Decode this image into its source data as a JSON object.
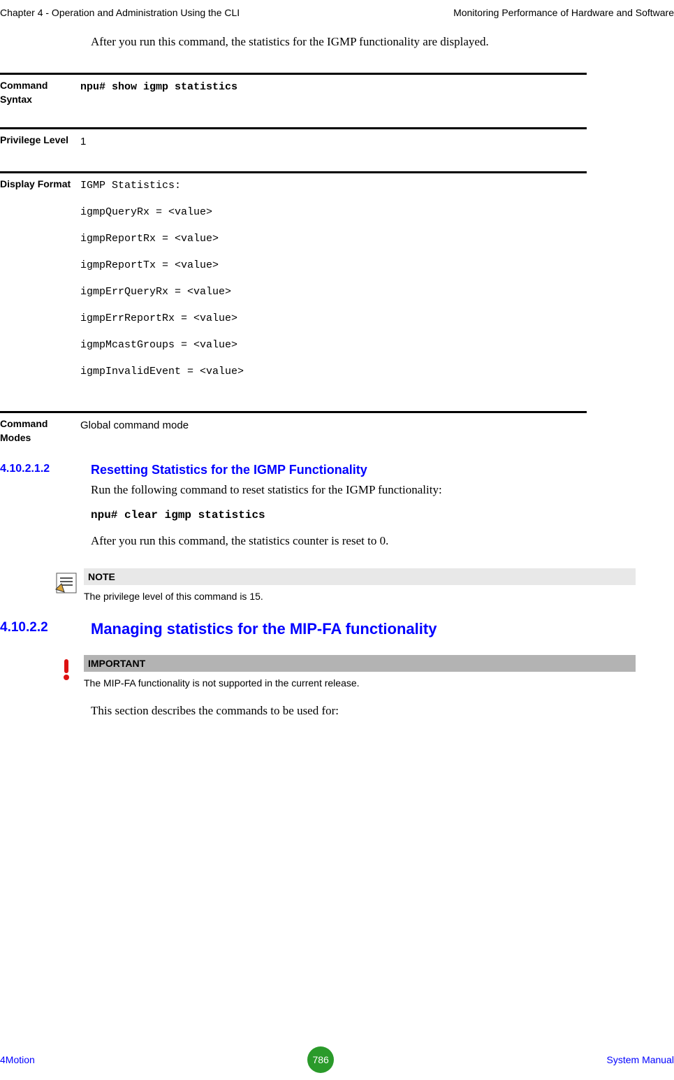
{
  "header": {
    "left": "Chapter 4 - Operation and Administration Using the CLI",
    "right": "Monitoring Performance of Hardware and Software"
  },
  "intro": "After you run this command, the statistics for the IGMP functionality are displayed.",
  "def_command_syntax": {
    "label": "Command Syntax",
    "value": "npu# show igmp statistics"
  },
  "def_privilege": {
    "label": "Privilege Level",
    "value": "1"
  },
  "def_display_format": {
    "label": "Display Format",
    "lines": [
      "IGMP Statistics:",
      "igmpQueryRx = <value>",
      "igmpReportRx = <value>",
      "igmpReportTx = <value>",
      "igmpErrQueryRx = <value>",
      "igmpErrReportRx = <value>",
      "igmpMcastGroups = <value>",
      "igmpInvalidEvent = <value>"
    ]
  },
  "def_command_modes": {
    "label": "Command Modes",
    "value": "Global command mode"
  },
  "sec1": {
    "num": "4.10.2.1.2",
    "title": "Resetting Statistics for the IGMP Functionality",
    "p1": "Run the following command to reset statistics for the IGMP functionality:",
    "cmd": "npu# clear igmp statistics",
    "p2": "After you run this command, the statistics counter is reset to 0."
  },
  "note": {
    "title": "NOTE",
    "text": "The privilege level of this command is 15."
  },
  "sec2": {
    "num": "4.10.2.2",
    "title": "Managing statistics for the MIP-FA functionality"
  },
  "important": {
    "title": "IMPORTANT",
    "text": "The MIP-FA functionality is not supported in the current release."
  },
  "closing": "This section describes the commands to be used for:",
  "footer": {
    "left": "4Motion",
    "page": "786",
    "right": "System Manual"
  }
}
